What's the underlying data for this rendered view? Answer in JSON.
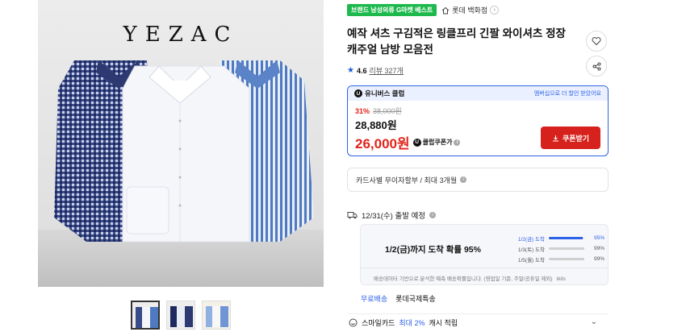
{
  "product": {
    "brand_logo": "YEZAC",
    "badge": "브랜드 남성의류 G마켓 베스트",
    "store": "롯데 백화점",
    "title": "예작 셔츠 구김적은 링클프리 긴팔 와이셔츠 정장 캐주얼 남방 모음전",
    "rating": "4.6",
    "review_link": "리뷰 327개"
  },
  "club": {
    "name": "유니버스 클럽",
    "u_mark": "U",
    "promo": "멤버십으로 더 할인 받았어요",
    "discount": "31%",
    "original_price": "38,000원",
    "price": "28,880원",
    "coupon_price": "26,000원",
    "coupon_label": "클럽쿠폰가",
    "coupon_button": "쿠폰받기"
  },
  "card": {
    "text": "카드사별 무이자할부 / 최대 3개월"
  },
  "shipping": {
    "depart": "12/31(수) 출발 예정",
    "headline": "1/2(금)까지 도착 확률 95%",
    "stats": [
      {
        "label": "1/2(금) 도착",
        "pct": "95%",
        "value": 0.95
      },
      {
        "label": "1/3(토) 도착",
        "pct": "99%",
        "value": 0.99
      },
      {
        "label": "1/5(월) 도착",
        "pct": "99%",
        "value": 0.99
      }
    ],
    "note": "배송데이터 기반으로 분석한 예측 배송확률입니다. (영업일 기준, 주말/공휴일 제외)",
    "note_logo": "Ikits"
  },
  "delivery": {
    "free": "무료배송",
    "carrier": "롯데국제특송"
  },
  "smile": {
    "prefix": "스마일카드",
    "highlight": "최대 2%",
    "suffix": "캐시 적립"
  },
  "icons": {
    "heart": "heart-icon",
    "share": "share-icon",
    "truck": "truck-icon",
    "info": "info-icon",
    "chevron_down": "chevron-down-icon"
  },
  "colors": {
    "accent_blue": "#2d62e8",
    "sale_red": "#e2231a",
    "badge_green": "#1eb94d",
    "coupon_button": "#d6211c"
  }
}
